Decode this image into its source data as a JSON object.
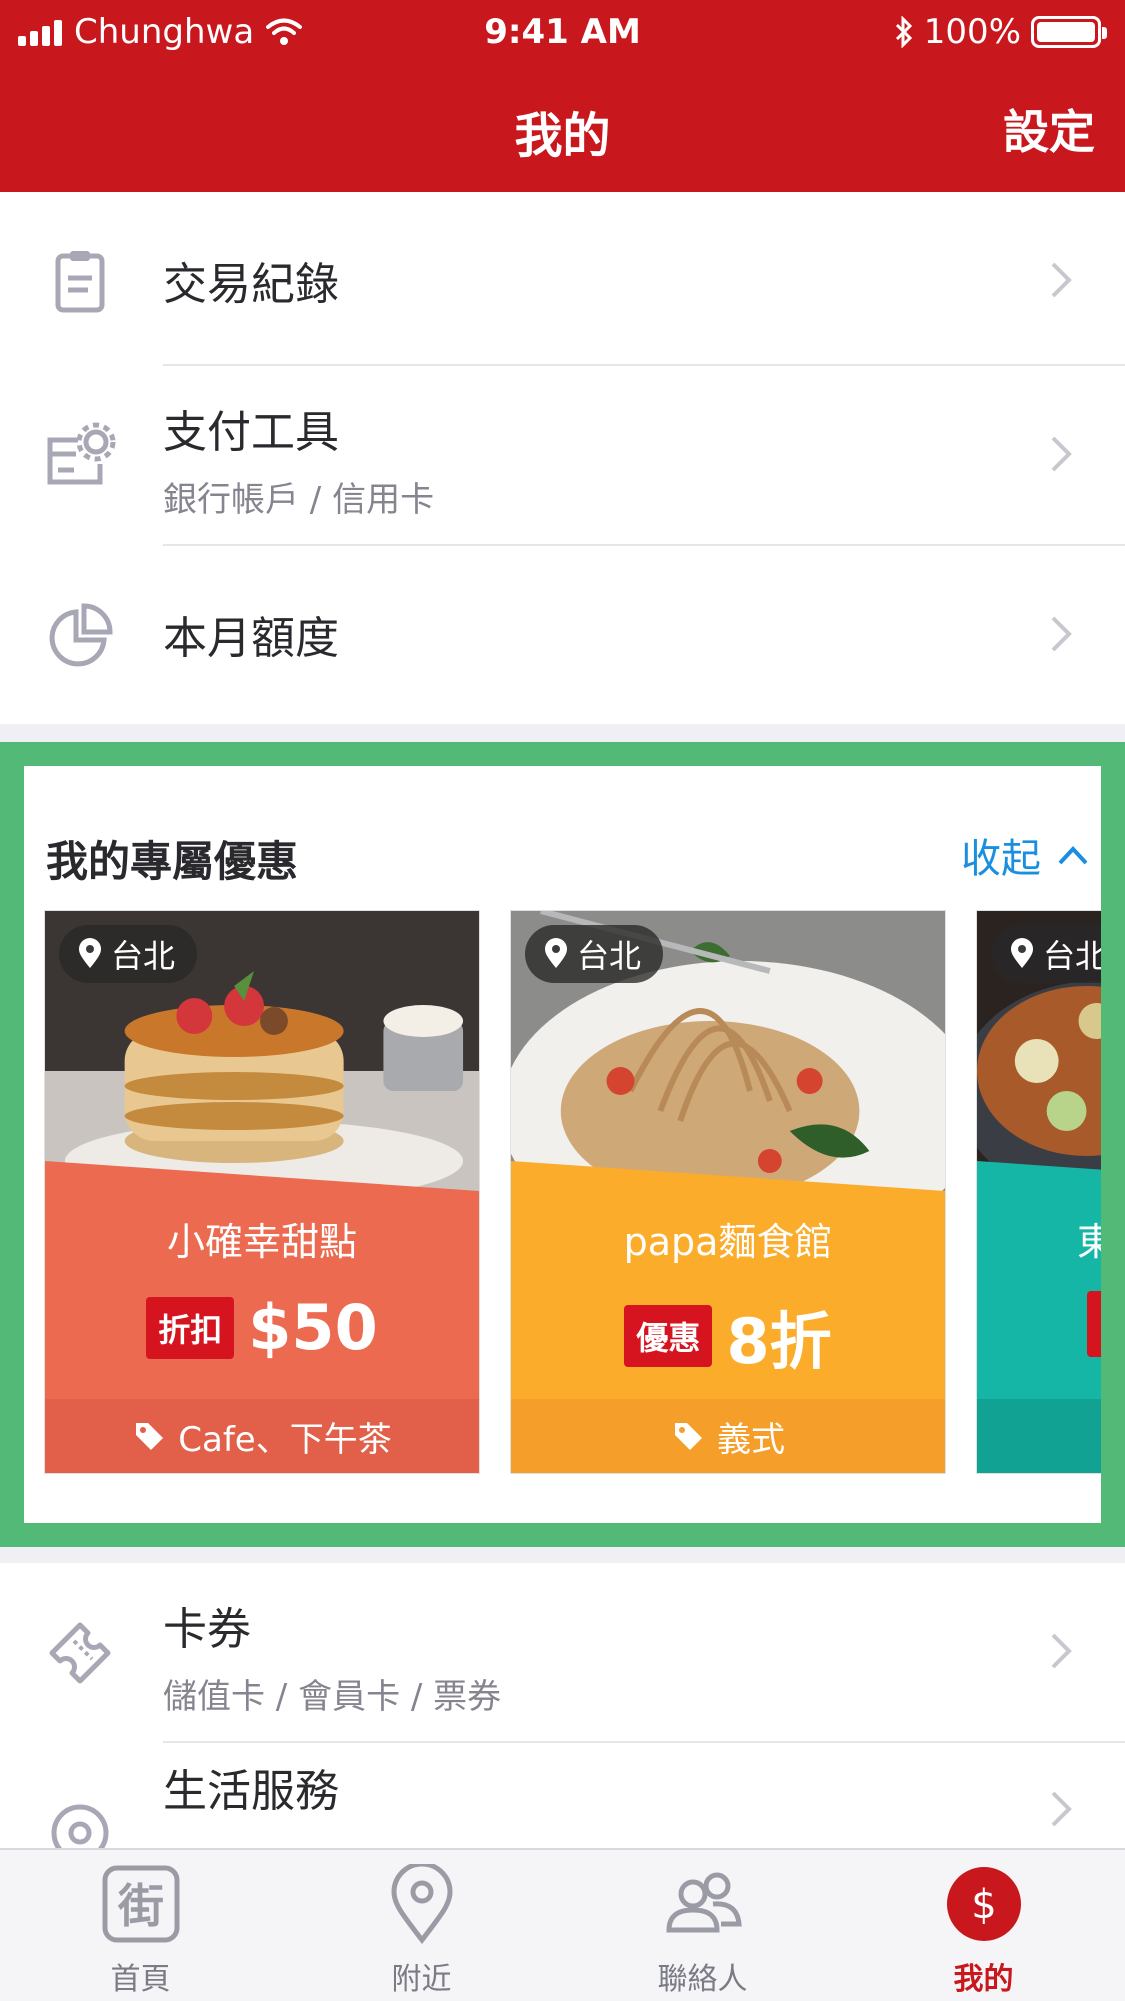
{
  "status_bar": {
    "carrier": "Chunghwa",
    "time": "9:41 AM",
    "battery": "100%"
  },
  "header": {
    "title": "我的",
    "settings_label": "設定"
  },
  "menu_top": [
    {
      "label": "交易紀錄",
      "sub": "",
      "icon": "clipboard-icon"
    },
    {
      "label": "支付工具",
      "sub": "銀行帳戶 / 信用卡",
      "icon": "card-gear-icon"
    },
    {
      "label": "本月額度",
      "sub": "",
      "icon": "pie-chart-icon"
    }
  ],
  "offers": {
    "title": "我的專屬優惠",
    "toggle_label": "收起",
    "cards": [
      {
        "location": "台北",
        "shop": "小確幸甜點",
        "badge": "折扣",
        "value": "$50",
        "category": "Cafe、下午茶",
        "color": "#ec6a50",
        "category_color": "#e2604a",
        "photo": "pancakes"
      },
      {
        "location": "台北",
        "shop": "papa麵食館",
        "badge": "優惠",
        "value": "8折",
        "category": "義式",
        "color": "#fbac2a",
        "category_color": "#f59f2a",
        "photo": "spaghetti"
      },
      {
        "location": "台北",
        "shop": "東",
        "badge": "",
        "value": "",
        "category": "",
        "color": "#16b6a6",
        "category_color": "#12a294",
        "photo": "stirfry"
      }
    ]
  },
  "menu_bottom": [
    {
      "label": "卡券",
      "sub": "儲值卡 / 會員卡 / 票券",
      "icon": "ticket-icon"
    },
    {
      "label": "生活服務",
      "sub": "",
      "icon": "location-circle-icon"
    }
  ],
  "tabs": [
    {
      "label": "首頁",
      "icon": "street-icon",
      "active": false
    },
    {
      "label": "附近",
      "icon": "map-pin-icon",
      "active": false
    },
    {
      "label": "聯絡人",
      "icon": "contacts-icon",
      "active": false
    },
    {
      "label": "我的",
      "icon": "dollar-icon",
      "active": true
    }
  ],
  "colors": {
    "brand_red": "#c8181e",
    "highlight_green": "#52b977",
    "link_blue": "#1a8fe0"
  }
}
